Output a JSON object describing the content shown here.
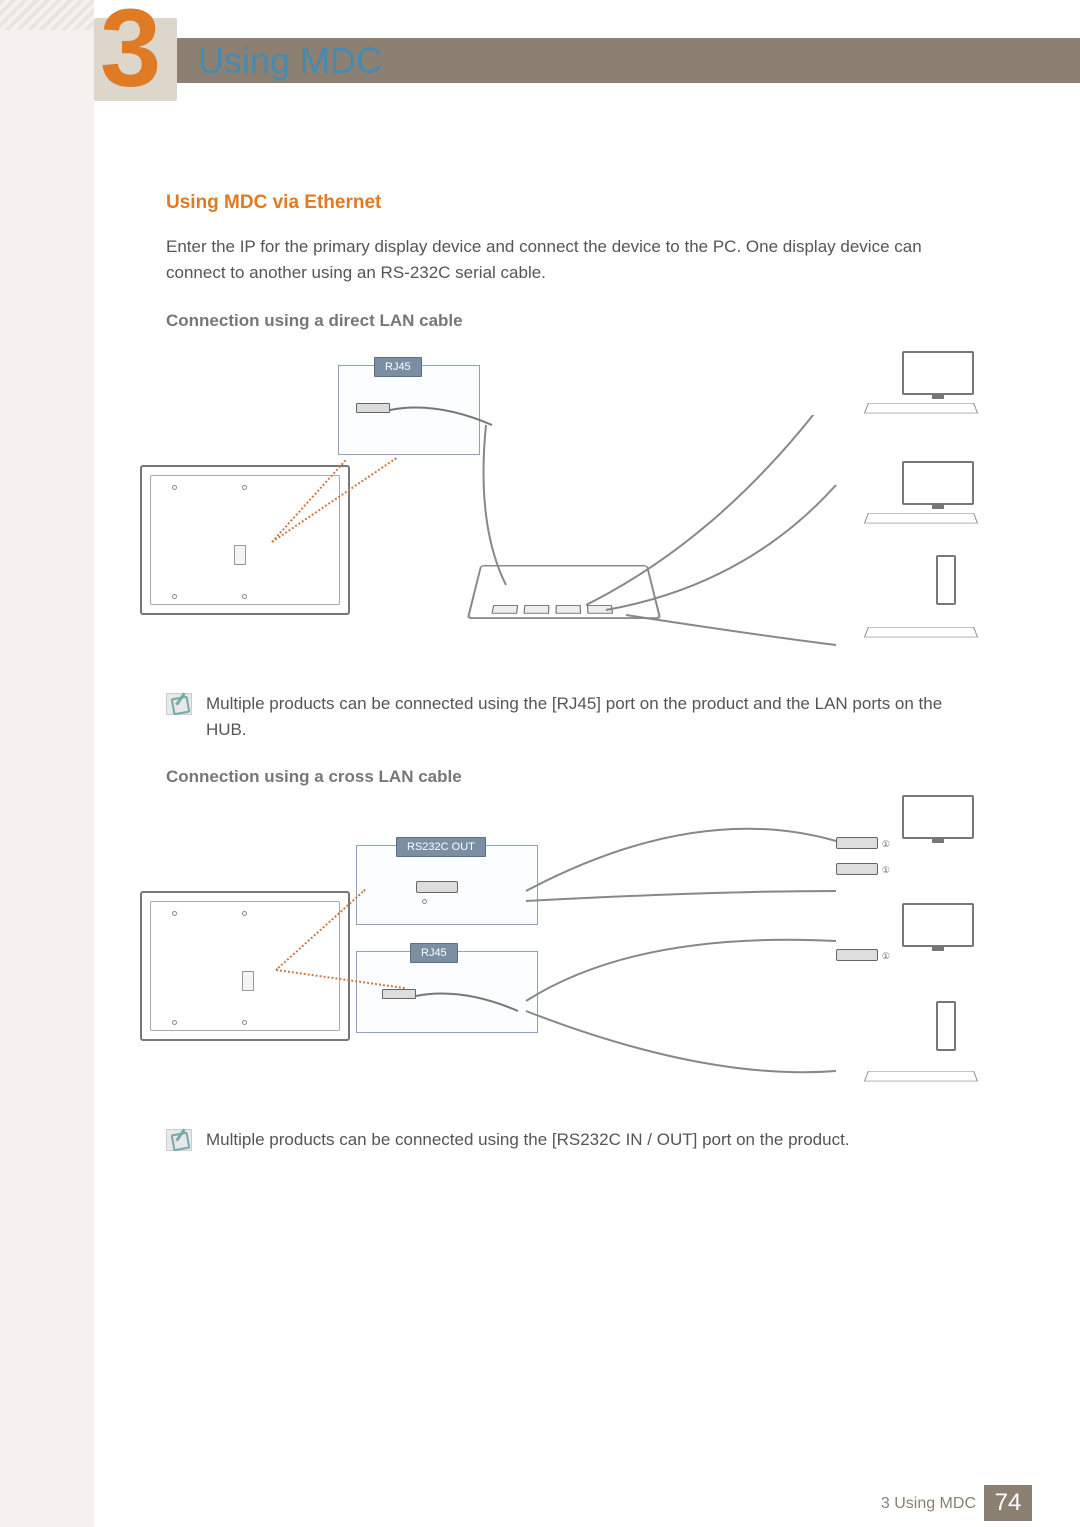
{
  "chapter": {
    "number": "3",
    "title": "Using MDC"
  },
  "section": {
    "heading_ethernet": "Using MDC via Ethernet",
    "intro": "Enter the IP for the primary display device and connect the device to the PC. One display device can connect to another using an RS-232C serial cable.",
    "sub_direct": "Connection using a direct LAN cable",
    "diagram1": {
      "label_rj45": "RJ45"
    },
    "note1": "Multiple products can be connected using the [RJ45] port on the product and the LAN ports on the HUB.",
    "sub_cross": "Connection using a cross LAN cable",
    "diagram2": {
      "label_rs232c": "RS232C OUT",
      "label_rj45": "RJ45"
    },
    "note2": "Multiple products can be connected using the [RS232C IN / OUT] port on the product."
  },
  "footer": {
    "label": "3 Using MDC",
    "page": "74"
  }
}
